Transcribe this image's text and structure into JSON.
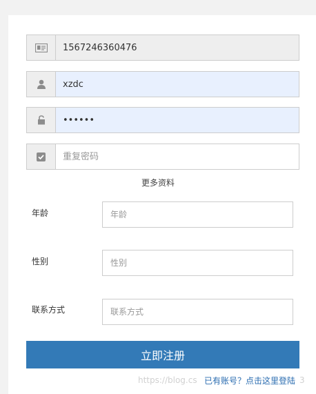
{
  "form": {
    "phone": {
      "value": "1567246360476",
      "icon": "id-card-icon"
    },
    "username": {
      "value": "xzdc",
      "icon": "user-icon"
    },
    "password": {
      "value": "••••••",
      "icon": "unlock-icon"
    },
    "confirm_password": {
      "placeholder": "重复密码",
      "icon": "check-square-icon"
    }
  },
  "more_info_label": "更多资料",
  "extra": {
    "age": {
      "label": "年龄",
      "placeholder": "年龄"
    },
    "gender": {
      "label": "性别",
      "placeholder": "性别"
    },
    "contact": {
      "label": "联系方式",
      "placeholder": "联系方式"
    }
  },
  "submit_label": "立即注册",
  "login_link": "已有账号？点击这里登陆",
  "watermark": "https://blog.cs",
  "watermark_tail": "3",
  "colors": {
    "primary": "#337ab7",
    "autofill": "#e8f0fe",
    "addon": "#eeeeee"
  }
}
